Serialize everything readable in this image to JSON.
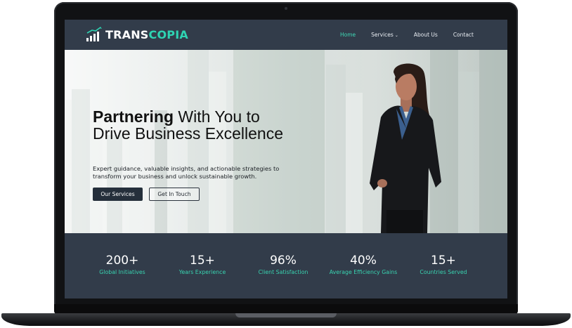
{
  "brand": {
    "name_part1": "TRANS",
    "name_part2": "COPIA",
    "accent_color": "#2ed3b2",
    "nav_bg": "#323c4a"
  },
  "nav": {
    "items": [
      {
        "label": "Home",
        "active": true
      },
      {
        "label": "Services",
        "has_dropdown": true
      },
      {
        "label": "About Us"
      },
      {
        "label": "Contact"
      }
    ],
    "dropdown_caret": "⌄"
  },
  "hero": {
    "headline_bold": "Partnering",
    "headline_rest": " With You to Drive Business Excellence",
    "subtext": "Expert guidance, valuable insights, and actionable strategies to transform your business and unlock sustainable growth.",
    "primary_button": "Our Services",
    "secondary_button": "Get In Touch"
  },
  "stats": [
    {
      "value": "200+",
      "label": "Global Initiatives"
    },
    {
      "value": "15+",
      "label": "Years Experience"
    },
    {
      "value": "96%",
      "label": "Client Satisfaction"
    },
    {
      "value": "40%",
      "label": "Average Efficiency Gains"
    },
    {
      "value": "15+",
      "label": "Countries Served"
    }
  ]
}
